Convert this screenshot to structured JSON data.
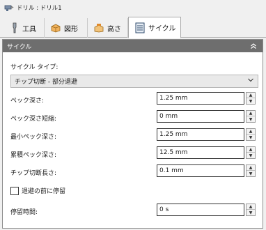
{
  "titlebar": {
    "title": "ドリル : ドリル1"
  },
  "tabs": [
    {
      "label": "工具",
      "icon": "tool-icon"
    },
    {
      "label": "図形",
      "icon": "shape-icon"
    },
    {
      "label": "高さ",
      "icon": "height-icon"
    },
    {
      "label": "サイクル",
      "icon": "cycle-icon",
      "active": true
    }
  ],
  "panel": {
    "title": "サイクル",
    "cycle_type_label": "サイクル タイプ:",
    "cycle_type_value": "チップ切断 - 部分退避",
    "fields": [
      {
        "label": "ペック深さ:",
        "value": "1.25 mm"
      },
      {
        "label": "ペック深さ短縮:",
        "value": "0 mm"
      },
      {
        "label": "最小ペック深さ:",
        "value": "1.25 mm"
      },
      {
        "label": "累積ペック深さ:",
        "value": "12.5 mm"
      },
      {
        "label": "チップ切断長さ:",
        "value": "0.1 mm"
      }
    ],
    "dwell_before_retract_label": "退避の前に停留",
    "dwell_before_retract_checked": false,
    "dwell_period_label": "停留時間:",
    "dwell_period_value": "0 s"
  }
}
